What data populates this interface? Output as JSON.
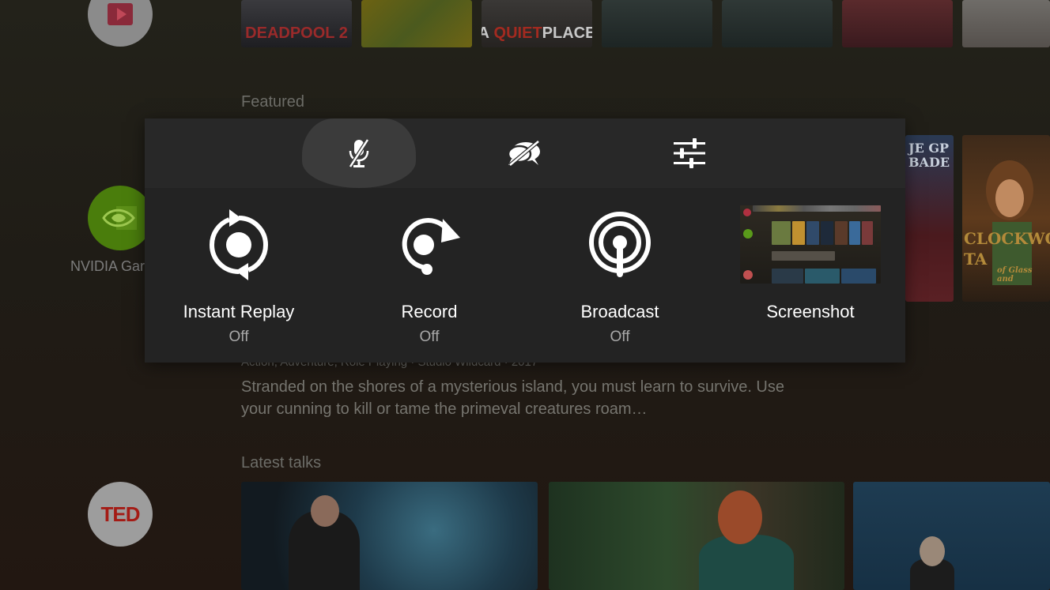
{
  "background": {
    "rows": {
      "featured_title": "Featured",
      "talks_title": "Latest talks"
    },
    "apps": {
      "nvidia_label": "NVIDIA Gar",
      "ted_label": "TED"
    },
    "posters": {
      "deadpool": "DEADPOOL 2",
      "quiet_place_a": "A",
      "quiet_place_quiet": "QUIET",
      "quiet_place_place": "PLACE"
    },
    "games": {
      "card1_text": "JE GP\nBADE",
      "card2_text": "CLOCKWO\nTA",
      "card2_sub": "of Glass and"
    },
    "game_meta": "Action, Adventure, Role Playing · Studio Wildcard · 2017",
    "game_desc": "Stranded on the shores of a mysterious island, you must learn to survive. Use your cunning to kill or tame the primeval creatures roam…"
  },
  "overlay": {
    "top_buttons": [
      {
        "icon": "mic-off-icon"
      },
      {
        "icon": "chat-off-icon"
      },
      {
        "icon": "settings-sliders-icon"
      }
    ],
    "features": [
      {
        "label": "Instant Replay",
        "status": "Off"
      },
      {
        "label": "Record",
        "status": "Off"
      },
      {
        "label": "Broadcast",
        "status": "Off"
      },
      {
        "label": "Screenshot"
      }
    ]
  },
  "colors": {
    "panel_bg": "#232323",
    "selected_bg": "#3b3b3b",
    "status_text": "#a8a8a8",
    "nvidia_green": "#76b900",
    "ted_red": "#e62b1e"
  }
}
